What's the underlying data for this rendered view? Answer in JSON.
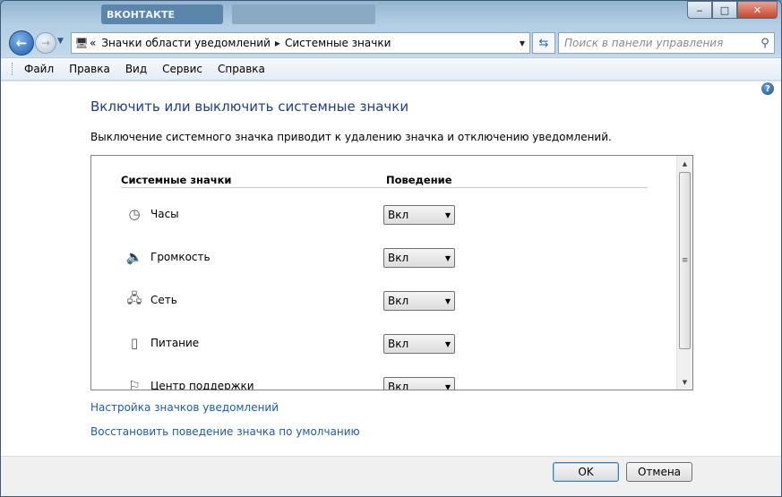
{
  "window": {
    "controls": {
      "minimize": "‒",
      "maximize": "□",
      "close": "✕"
    }
  },
  "address": {
    "prefix": "«",
    "crumbs": [
      "Значки области уведомлений",
      "Системные значки"
    ],
    "separator": "▸"
  },
  "search": {
    "placeholder": "Поиск в панели управления"
  },
  "menu": [
    "Файл",
    "Правка",
    "Вид",
    "Сервис",
    "Справка"
  ],
  "page": {
    "title": "Включить или выключить системные значки",
    "description": "Выключение системного значка приводит к удалению значка и отключению уведомлений."
  },
  "table": {
    "headers": {
      "name": "Системные значки",
      "behavior": "Поведение"
    },
    "rows": [
      {
        "label": "Часы",
        "value": "Вкл",
        "icon": "clock-icon"
      },
      {
        "label": "Громкость",
        "value": "Вкл",
        "icon": "speaker-icon"
      },
      {
        "label": "Сеть",
        "value": "Вкл",
        "icon": "network-icon"
      },
      {
        "label": "Питание",
        "value": "Вкл",
        "icon": "battery-icon"
      },
      {
        "label": "Центр поддержки",
        "value": "Вкл",
        "icon": "flag-icon"
      }
    ]
  },
  "links": {
    "customize": "Настройка значков уведомлений",
    "restore": "Восстановить поведение значка по умолчанию"
  },
  "buttons": {
    "ok": "OK",
    "cancel": "Отмена"
  },
  "colors": {
    "title_text": "#1e3e8c",
    "link": "#1d5cac",
    "window_frame": "#a7c6df"
  }
}
